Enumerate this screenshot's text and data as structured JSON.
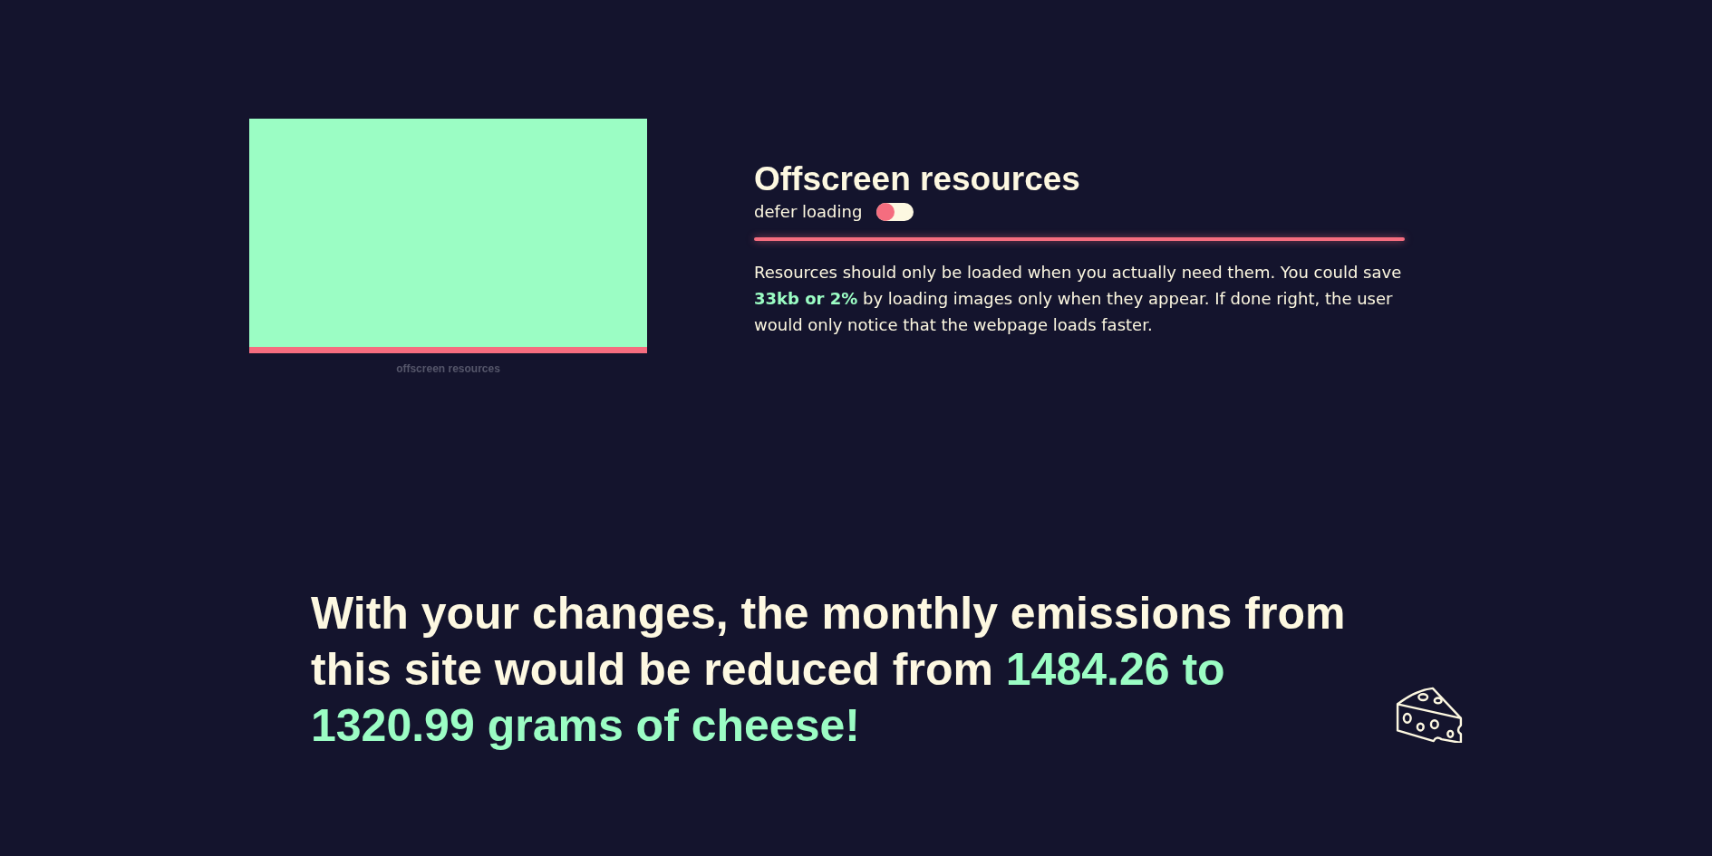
{
  "preview": {
    "kind": "picture",
    "caption": "offscreen resources"
  },
  "setting": {
    "title": "Offscreen resources",
    "toggle_label": "defer loading",
    "on": false,
    "description": "Resources should only be loaded when you actually need them. You could save **33kb or 2%** by loading images only when they appear. If done right, the user would only notice that the webpage loads faster."
  },
  "summary": {
    "text": "With your changes, the monthly emissions from this site would be reduced from **1484.26 to 1320.99 grams of cheese!**"
  }
}
